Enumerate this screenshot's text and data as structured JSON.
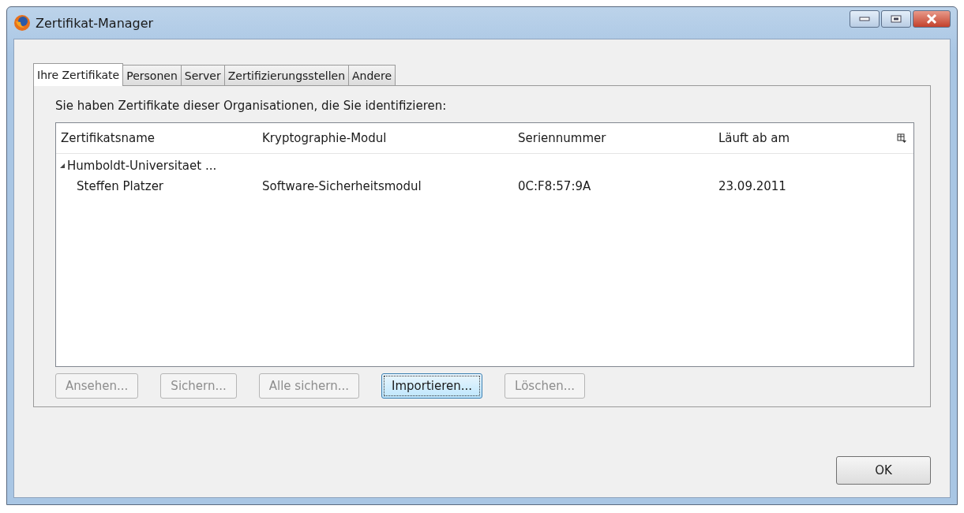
{
  "window": {
    "title": "Zertifikat-Manager"
  },
  "tabs": [
    {
      "label": "Ihre Zertifikate",
      "selected": true
    },
    {
      "label": "Personen",
      "selected": false
    },
    {
      "label": "Server",
      "selected": false
    },
    {
      "label": "Zertifizierungsstellen",
      "selected": false
    },
    {
      "label": "Andere",
      "selected": false
    }
  ],
  "intro": "Sie haben Zertifikate dieser Organisationen, die Sie identifizieren:",
  "tree": {
    "columns": [
      "Zertifikatsname",
      "Kryptographie-Modul",
      "Seriennummer",
      "Läuft ab am"
    ],
    "rows": [
      {
        "name": "Humboldt-Universitaet ...",
        "expanded": true,
        "children": [
          {
            "cells": [
              "Steffen Platzer",
              "Software-Sicherheitsmodul",
              "0C:F8:57:9A",
              "23.09.2011"
            ]
          }
        ]
      }
    ]
  },
  "buttons": [
    {
      "label": "Ansehen...",
      "disabled": true,
      "focused": false
    },
    {
      "label": "Sichern...",
      "disabled": true,
      "focused": false
    },
    {
      "label": "Alle sichern...",
      "disabled": true,
      "focused": false
    },
    {
      "label": "Importieren...",
      "disabled": false,
      "focused": true
    },
    {
      "label": "Löschen...",
      "disabled": true,
      "focused": false
    }
  ],
  "ok_button": "OK"
}
